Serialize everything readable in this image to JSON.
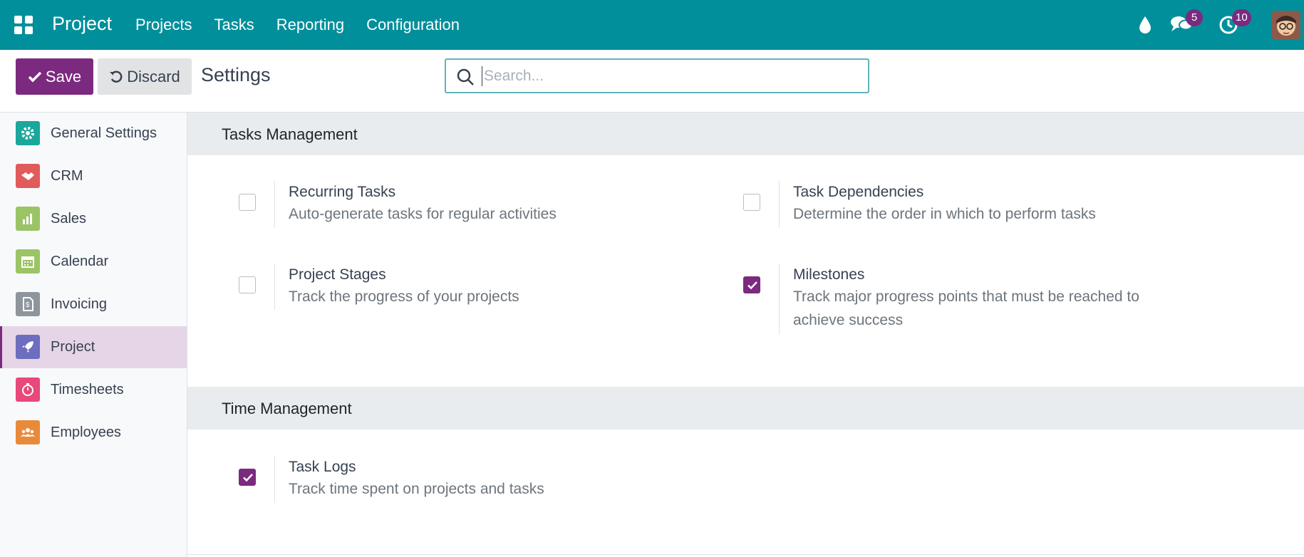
{
  "navbar": {
    "brand": "Project",
    "menu": [
      "Projects",
      "Tasks",
      "Reporting",
      "Configuration"
    ],
    "messages_count": "5",
    "activities_count": "10",
    "bg_color": "#018f9b"
  },
  "control": {
    "save_label": "Save",
    "discard_label": "Discard",
    "title": "Settings",
    "search_placeholder": "Search...",
    "search_value": ""
  },
  "sidebar": {
    "items": [
      {
        "label": "General Settings",
        "icon": "gear-icon",
        "color": "#1aa79c"
      },
      {
        "label": "CRM",
        "icon": "handshake-icon",
        "color": "#e05b5b"
      },
      {
        "label": "Sales",
        "icon": "sales-chart-icon",
        "color": "#9bc466"
      },
      {
        "label": "Calendar",
        "icon": "calendar-icon",
        "color": "#9bc466"
      },
      {
        "label": "Invoicing",
        "icon": "invoice-icon",
        "color": "#8e959c"
      },
      {
        "label": "Project",
        "icon": "rocket-icon",
        "color": "#6d6ec0"
      },
      {
        "label": "Timesheets",
        "icon": "stopwatch-icon",
        "color": "#e8487a"
      },
      {
        "label": "Employees",
        "icon": "people-icon",
        "color": "#e98a3b"
      }
    ],
    "active": "Project"
  },
  "sections": {
    "tasks_management": {
      "title": "Tasks Management",
      "settings": [
        {
          "title": "Recurring Tasks",
          "desc": "Auto-generate tasks for regular activities",
          "checked": false
        },
        {
          "title": "Task Dependencies",
          "desc": "Determine the order in which to perform tasks",
          "checked": false
        },
        {
          "title": "Project Stages",
          "desc": "Track the progress of your projects",
          "checked": false
        },
        {
          "title": "Milestones",
          "desc": "Track major progress points that must be reached to achieve success",
          "checked": true
        }
      ]
    },
    "time_management": {
      "title": "Time Management",
      "settings": [
        {
          "title": "Task Logs",
          "desc": "Track time spent on projects and tasks",
          "checked": true
        }
      ]
    }
  },
  "colors": {
    "accent": "#7b2a7f",
    "navbar": "#018f9b",
    "section_bg": "#e9ecef"
  }
}
